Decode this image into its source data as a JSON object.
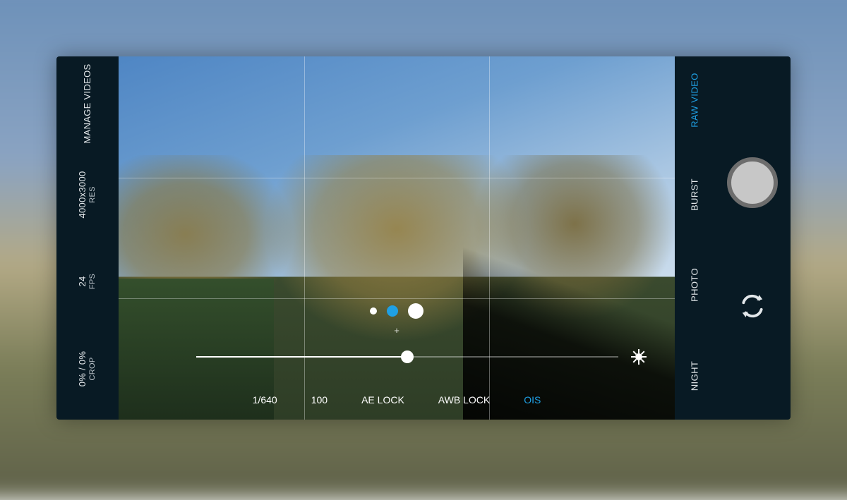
{
  "leftRail": {
    "crop": {
      "value": "0% / 0%",
      "label": "CROP"
    },
    "fps": {
      "value": "24",
      "label": "FPS"
    },
    "res": {
      "value": "4000x3000",
      "label": "RES"
    },
    "manage": {
      "label": "MANAGE VIDEOS"
    }
  },
  "exposure": {
    "slider_pct": 50,
    "controls": {
      "shutter": "1/640",
      "iso": "100",
      "aelock": "AE LOCK",
      "awblock": "AWB LOCK",
      "ois": "OIS"
    },
    "active_control": "ois"
  },
  "focus": {
    "dots": [
      "s",
      "m-sel",
      "l"
    ]
  },
  "modes": {
    "items": [
      "NIGHT",
      "PHOTO",
      "BURST",
      "RAW VIDEO"
    ],
    "active": "RAW VIDEO"
  },
  "colors": {
    "accent": "#1fa0e4",
    "panel": "#081a24"
  }
}
